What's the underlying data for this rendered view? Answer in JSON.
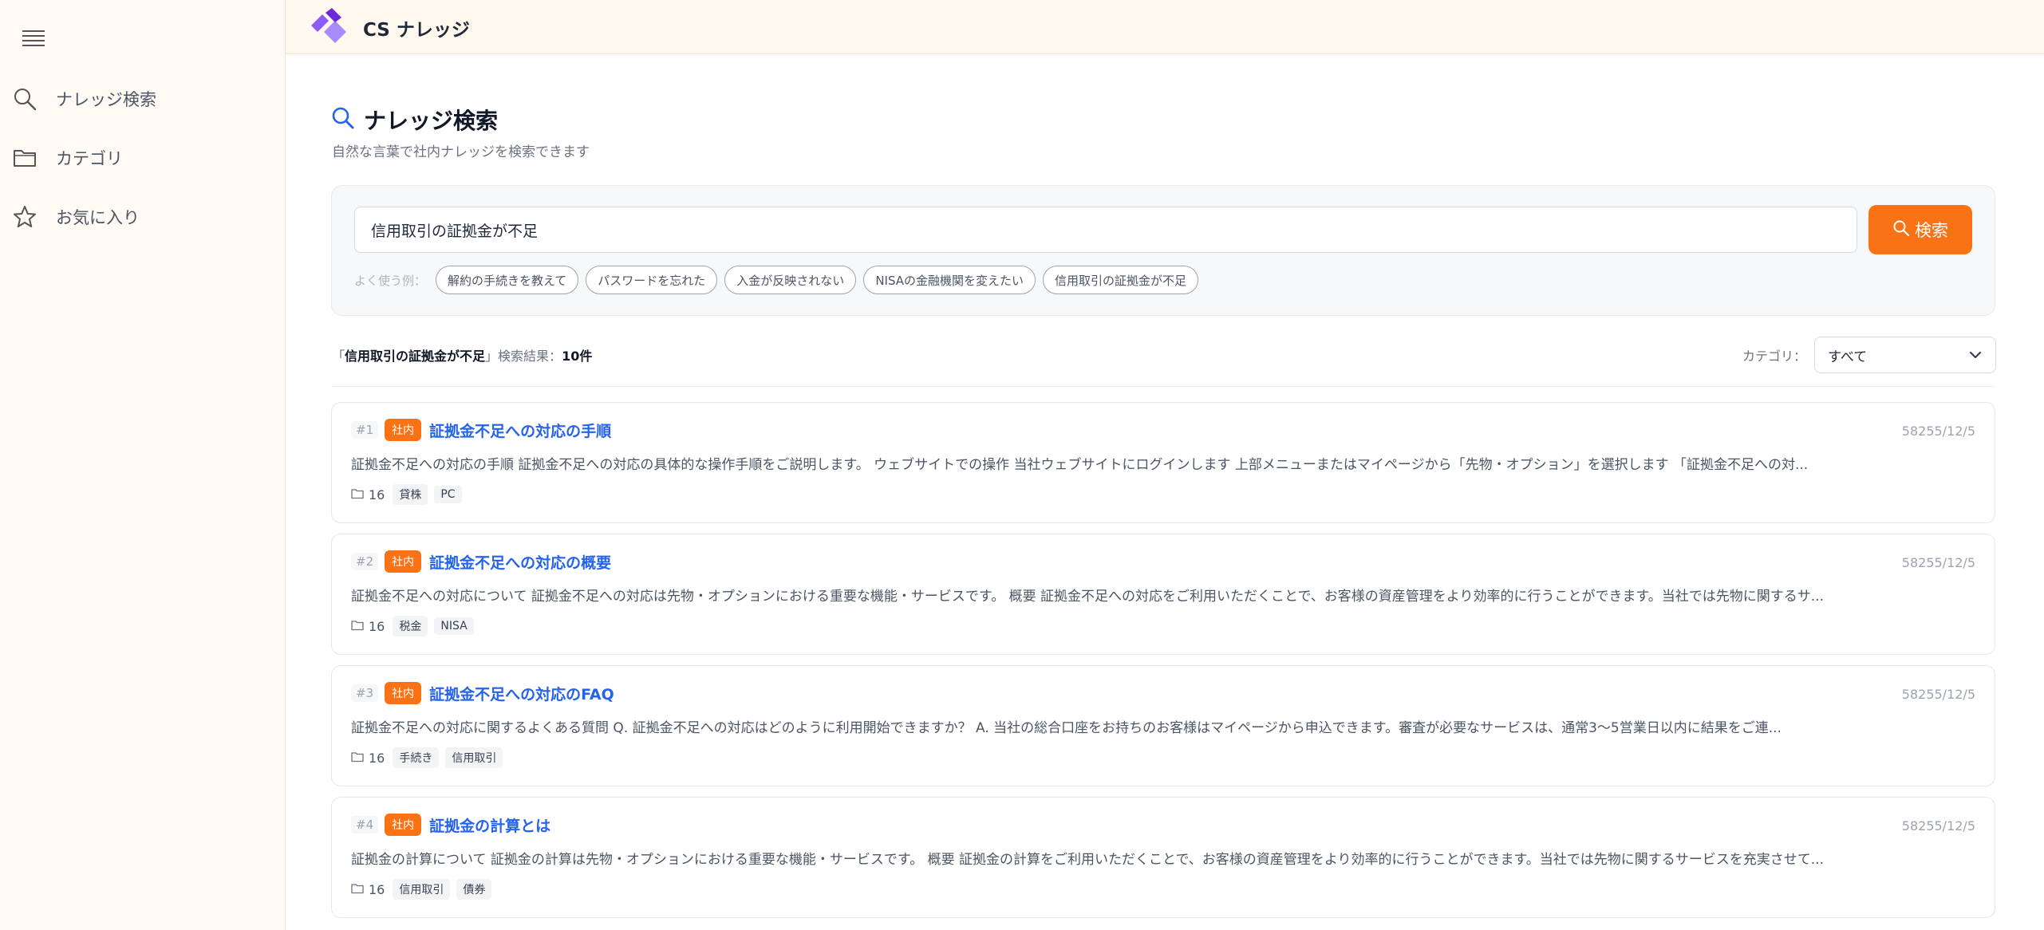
{
  "header": {
    "app_title": "CS ナレッジ"
  },
  "sidebar": {
    "items": [
      {
        "label": "ナレッジ検索",
        "icon": "search-icon"
      },
      {
        "label": "カテゴリ",
        "icon": "folder-icon"
      },
      {
        "label": "お気に入り",
        "icon": "star-icon"
      }
    ]
  },
  "main": {
    "title": "ナレッジ検索",
    "subtitle": "自然な言葉で社内ナレッジを検索できます",
    "search": {
      "value": "信用取引の証拠金が不足",
      "button_label": "検索",
      "examples_label": "よく使う例：",
      "examples": [
        "解約の手続きを教えて",
        "パスワードを忘れた",
        "入金が反映されない",
        "NISAの金融機関を変えたい",
        "信用取引の証拠金が不足"
      ]
    },
    "summary": {
      "open_quote": "「",
      "query": "信用取引の証拠金が不足",
      "close_quote": "」",
      "label": "検索結果：",
      "count": "10件"
    },
    "filter": {
      "label": "カテゴリ：",
      "value": "すべて"
    },
    "results": [
      {
        "rank": "#1",
        "badge": "社内",
        "title": "証拠金不足への対応の手順",
        "date": "58255/12/5",
        "snippet": "証拠金不足への対応の手順 証拠金不足への対応の具体的な操作手順をご説明します。 ウェブサイトでの操作 当社ウェブサイトにログインします 上部メニューまたはマイページから「先物・オプション」を選択します 「証拠金不足への対...",
        "folder_count": "16",
        "tags": [
          "貸株",
          "PC"
        ]
      },
      {
        "rank": "#2",
        "badge": "社内",
        "title": "証拠金不足への対応の概要",
        "date": "58255/12/5",
        "snippet": "証拠金不足への対応について 証拠金不足への対応は先物・オプションにおける重要な機能・サービスです。 概要 証拠金不足への対応をご利用いただくことで、お客様の資産管理をより効率的に行うことができます。当社では先物に関するサ...",
        "folder_count": "16",
        "tags": [
          "税金",
          "NISA"
        ]
      },
      {
        "rank": "#3",
        "badge": "社内",
        "title": "証拠金不足への対応のFAQ",
        "date": "58255/12/5",
        "snippet": "証拠金不足への対応に関するよくある質問 Q. 証拠金不足への対応はどのように利用開始できますか？ A. 当社の総合口座をお持ちのお客様はマイページから申込できます。審査が必要なサービスは、通常3〜5営業日以内に結果をご連...",
        "folder_count": "16",
        "tags": [
          "手続き",
          "信用取引"
        ]
      },
      {
        "rank": "#4",
        "badge": "社内",
        "title": "証拠金の計算とは",
        "date": "58255/12/5",
        "snippet": "証拠金の計算について 証拠金の計算は先物・オプションにおける重要な機能・サービスです。 概要 証拠金の計算をご利用いただくことで、お客様の資産管理をより効率的に行うことができます。当社では先物に関するサービスを充実させて...",
        "folder_count": "16",
        "tags": [
          "信用取引",
          "債券"
        ]
      }
    ]
  },
  "colors": {
    "accent": "#f97316",
    "link": "#2563eb",
    "sidebar_bg": "#fffaf3",
    "header_bg": "#fff8ee"
  }
}
